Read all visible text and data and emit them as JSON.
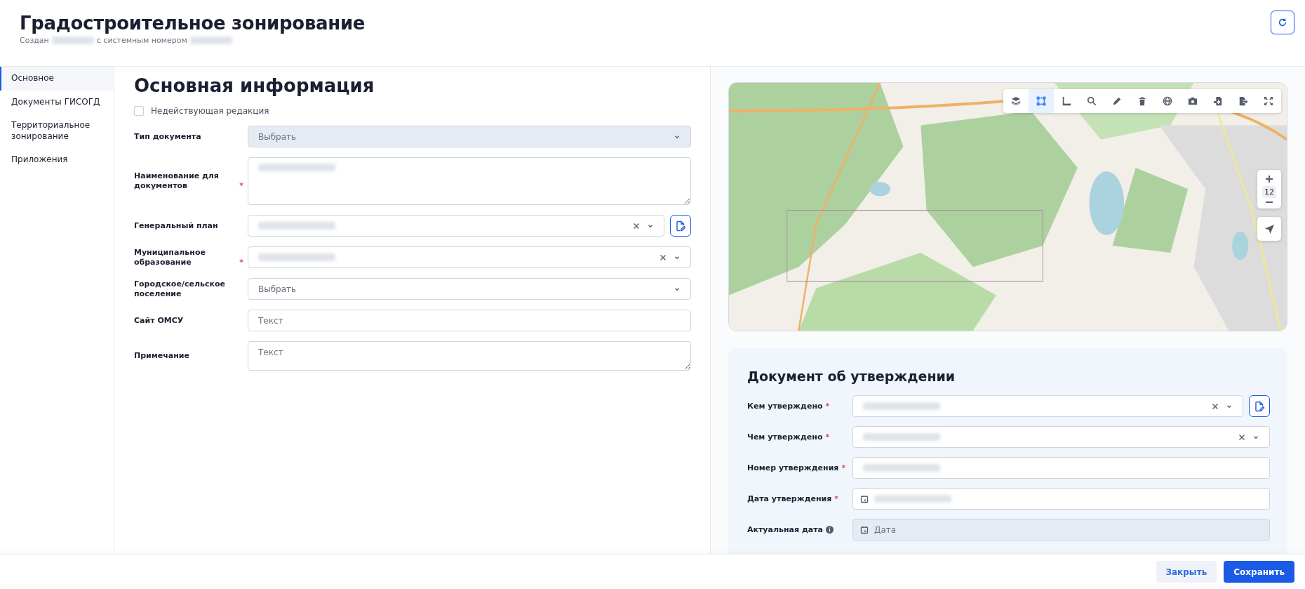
{
  "header": {
    "title": "Градостроительное зонирование",
    "subtitle": [
      {
        "text": "Создан",
        "redacted_after": true
      },
      {
        "text": "с системным номером",
        "redacted_after": true
      }
    ]
  },
  "sidebar": {
    "items": [
      {
        "label": "Основное",
        "selected": true
      },
      {
        "label": "Документы ГИСОГД",
        "selected": false
      },
      {
        "label": "Территориальное зонирование",
        "selected": false
      },
      {
        "label": "Приложения",
        "selected": false
      }
    ]
  },
  "main": {
    "title": "Основная информация",
    "inactive_checkbox": {
      "label": "Недействующая редакция",
      "checked": false
    },
    "fields": [
      {
        "label": "Тип документа",
        "kind": "select",
        "placeholder": "Выбрать",
        "disabled": true
      },
      {
        "label": "Наименование для документов",
        "required_mark": "*",
        "kind": "textarea",
        "redacted": true
      },
      {
        "label": "Генеральный план",
        "kind": "select",
        "redacted": true,
        "clearable": true,
        "side_button": true
      },
      {
        "label": "Муниципальное образование",
        "required_mark": "*",
        "kind": "select",
        "redacted": true,
        "clearable": true
      },
      {
        "label": "Городское/сельское поселение",
        "kind": "select",
        "placeholder": "Выбрать"
      },
      {
        "label": "Сайт ОМСУ",
        "kind": "text",
        "placeholder": "Текст"
      },
      {
        "label": "Примечание",
        "kind": "textarea",
        "placeholder": "Текст"
      }
    ]
  },
  "map": {
    "tools": [
      {
        "selected": false
      },
      {
        "selected": true
      },
      {
        "selected": false
      },
      {
        "selected": false
      },
      {
        "selected": false
      },
      {
        "selected": false
      },
      {
        "selected": false
      },
      {
        "selected": false
      },
      {
        "selected": false
      },
      {
        "selected": false
      },
      {
        "selected": false
      }
    ],
    "zoom_level": "12"
  },
  "approval": {
    "title": "Документ об утверждении",
    "fields": [
      {
        "label": "Кем утверждено",
        "required_mark": "*",
        "kind": "select",
        "redacted": true,
        "clearable": true,
        "side_button": true
      },
      {
        "label": "Чем утверждено",
        "required_mark": "*",
        "kind": "select",
        "redacted": true,
        "clearable": true
      },
      {
        "label": "Номер утверждения",
        "required_mark": "*",
        "kind": "text",
        "redacted": true
      },
      {
        "label": "Дата утверждения",
        "required_mark": "*",
        "kind": "date",
        "redacted": true
      },
      {
        "label": "Актуальная дата",
        "info": true,
        "kind": "date",
        "placeholder": "Дата",
        "disabled": true
      }
    ]
  },
  "footer": {
    "buttons": [
      {
        "label": "Закрыть",
        "kind": "secondary"
      },
      {
        "label": "Сохранить",
        "kind": "primary"
      }
    ]
  }
}
